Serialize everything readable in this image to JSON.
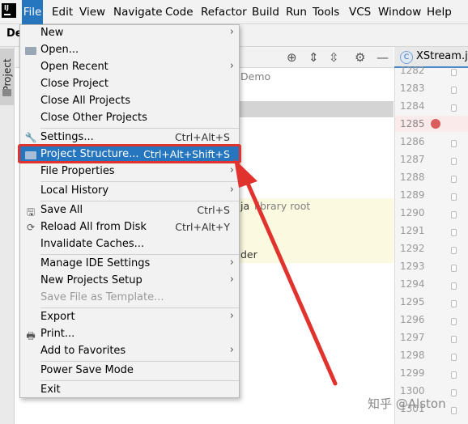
{
  "menubar": {
    "logo": "IJ",
    "items": [
      "File",
      "Edit",
      "View",
      "Navigate",
      "Code",
      "Refactor",
      "Build",
      "Run",
      "Tools",
      "VCS",
      "Window",
      "Help"
    ]
  },
  "project": {
    "tab_short": "De",
    "side_tab": "Project",
    "text_demo": "Demo",
    "text_library_root": "library root",
    "text_ja": "ja",
    "text_der": "der"
  },
  "editor": {
    "tab_label": "XStream.java",
    "tab_icon": "C",
    "line_numbers": [
      "1282",
      "1283",
      "1284",
      "1285",
      "1286",
      "1287",
      "1288",
      "1289",
      "1290",
      "1291",
      "1292",
      "1293",
      "1294",
      "1295",
      "1296",
      "1297",
      "1298",
      "1299",
      "1300",
      "1301"
    ]
  },
  "file_menu": {
    "new": "New",
    "open": "Open...",
    "open_recent": "Open Recent",
    "close_project": "Close Project",
    "close_all_projects": "Close All Projects",
    "close_other_projects": "Close Other Projects",
    "settings": "Settings...",
    "settings_shortcut": "Ctrl+Alt+S",
    "project_structure": "Project Structure...",
    "project_structure_shortcut": "Ctrl+Alt+Shift+S",
    "file_properties": "File Properties",
    "local_history": "Local History",
    "save_all": "Save All",
    "save_all_shortcut": "Ctrl+S",
    "reload_all": "Reload All from Disk",
    "reload_all_shortcut": "Ctrl+Alt+Y",
    "invalidate_caches": "Invalidate Caches...",
    "manage_ide_settings": "Manage IDE Settings",
    "new_projects_setup": "New Projects Setup",
    "save_file_as_template": "Save File as Template...",
    "export": "Export",
    "print": "Print...",
    "add_to_favorites": "Add to Favorites",
    "power_save_mode": "Power Save Mode",
    "exit": "Exit"
  },
  "watermark": "知乎 @Alston"
}
